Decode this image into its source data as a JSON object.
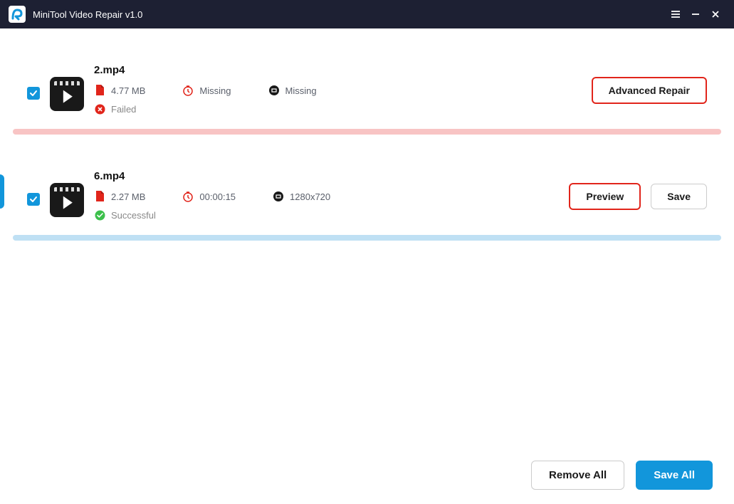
{
  "app": {
    "title": "MiniTool Video Repair v1.0"
  },
  "files": [
    {
      "name": "2.mp4",
      "size": "4.77 MB",
      "duration": "Missing",
      "resolution": "Missing",
      "status": "Failed",
      "status_type": "failed",
      "actions": {
        "advanced": "Advanced Repair"
      }
    },
    {
      "name": "6.mp4",
      "size": "2.27 MB",
      "duration": "00:00:15",
      "resolution": "1280x720",
      "status": "Successful",
      "status_type": "success",
      "actions": {
        "preview": "Preview",
        "save": "Save"
      }
    }
  ],
  "footer": {
    "remove_all": "Remove All",
    "save_all": "Save All"
  }
}
